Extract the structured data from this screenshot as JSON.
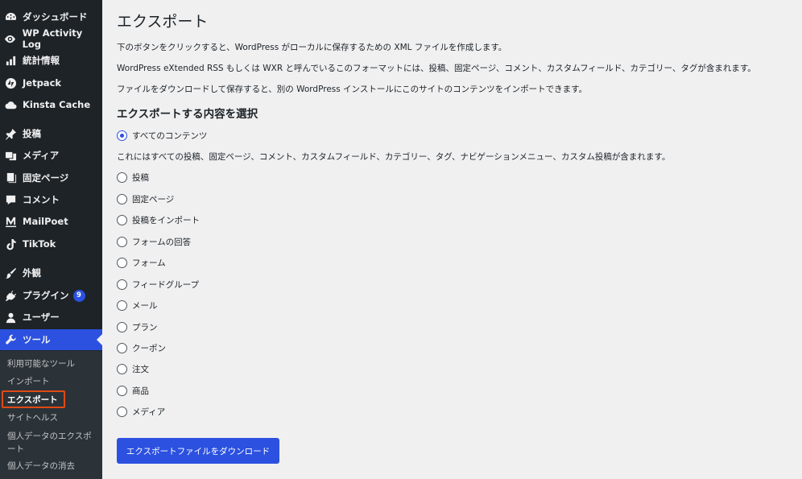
{
  "sidebar": {
    "items": [
      {
        "label": "ダッシュボード",
        "icon": "dashboard-icon"
      },
      {
        "label": "WP Activity Log",
        "icon": "eye-icon"
      },
      {
        "label": "統計情報",
        "icon": "stats-bars-icon"
      },
      {
        "label": "Jetpack",
        "icon": "jetpack-icon"
      },
      {
        "label": "Kinsta Cache",
        "icon": "cloud-icon"
      },
      {
        "label": "投稿",
        "icon": "pin-icon"
      },
      {
        "label": "メディア",
        "icon": "media-icon"
      },
      {
        "label": "固定ページ",
        "icon": "pages-icon"
      },
      {
        "label": "コメント",
        "icon": "comment-icon"
      },
      {
        "label": "MailPoet",
        "icon": "mailpoet-icon"
      },
      {
        "label": "TikTok",
        "icon": "tiktok-icon"
      },
      {
        "label": "外観",
        "icon": "brush-icon"
      },
      {
        "label": "プラグイン",
        "icon": "plugin-icon",
        "badge": "9"
      },
      {
        "label": "ユーザー",
        "icon": "user-icon"
      },
      {
        "label": "ツール",
        "icon": "wrench-icon"
      }
    ],
    "submenu": [
      "利用可能なツール",
      "インポート",
      "エクスポート",
      "サイトヘルス",
      "個人データのエクスポート",
      "個人データの消去"
    ]
  },
  "main": {
    "title": "エクスポート",
    "paragraphs": [
      "下のボタンをクリックすると、WordPress がローカルに保存するための XML ファイルを作成します。",
      "WordPress eXtended RSS もしくは WXR と呼んでいるこのフォーマットには、投稿、固定ページ、コメント、カスタムフィールド、カテゴリー、タグが含まれます。",
      "ファイルをダウンロードして保存すると、別の WordPress インストールにこのサイトのコンテンツをインポートできます。"
    ],
    "section_title": "エクスポートする内容を選択",
    "all_content_label": "すべてのコンテンツ",
    "all_content_desc": "これにはすべての投稿、固定ページ、コメント、カスタムフィールド、カテゴリー、タグ、ナビゲーションメニュー、カスタム投稿が含まれます。",
    "options": [
      "投稿",
      "固定ページ",
      "投稿をインポート",
      "フォームの回答",
      "フォーム",
      "フィードグループ",
      "メール",
      "プラン",
      "クーポン",
      "注文",
      "商品",
      "メディア"
    ],
    "download_button": "エクスポートファイルをダウンロード"
  },
  "colors": {
    "sidebar_bg": "#1d2327",
    "accent": "#2c51e0",
    "highlight_box": "#e04a14",
    "page_bg": "#f0f0f1"
  }
}
